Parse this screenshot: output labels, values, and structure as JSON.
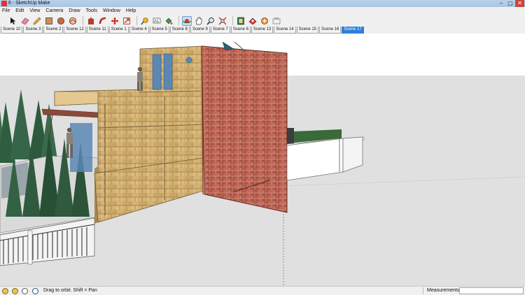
{
  "window": {
    "title": "6 - SketchUp Make",
    "controls": [
      "–",
      "▢",
      "✕"
    ]
  },
  "menu": [
    "File",
    "Edit",
    "View",
    "Camera",
    "Draw",
    "Tools",
    "Window",
    "Help"
  ],
  "toolbar": {
    "tools": [
      "select-tool-icon",
      "eraser-tool-icon",
      "pencil-tool-icon",
      "rectangle-tool-icon",
      "circle-tool-icon",
      "arc-tool-icon",
      "push-pull-tool-icon",
      "follow-me-tool-icon",
      "move-tool-icon",
      "rotate-tool-icon",
      "scale-tool-icon",
      "offset-tool-icon",
      "tape-measure-tool-icon",
      "text-tool-icon",
      "paint-bucket-tool-icon",
      "orbit-tool-icon",
      "pan-tool-icon",
      "zoom-tool-icon",
      "zoom-extents-tool-icon",
      "3d-warehouse-icon",
      "extension-warehouse-icon",
      "share-model-icon",
      "layout-icon"
    ],
    "active_tool": "orbit-tool-icon"
  },
  "scene_tabs": {
    "items": [
      "Scene 10",
      "Scene 3",
      "Scene 2",
      "Scene 12",
      "Scene 11",
      "Scene 1",
      "Scene 4",
      "Scene 5",
      "Scene 8",
      "Scene 9",
      "Scene 7",
      "Scene 6",
      "Scene 13",
      "Scene 14",
      "Scene 15",
      "Scene 16",
      "Scene 17"
    ],
    "active": "Scene 17"
  },
  "statusbar": {
    "message": "Drag to orbit.  Shift = Pan",
    "measurements_label": "Measurements",
    "measurements_value": ""
  },
  "colors": {
    "accent": "#2f7fd8",
    "sky": "#ffffff",
    "ground": "#dedede",
    "sandstone": "#d4b274",
    "brick": "#b55a4a",
    "tree": "#2f5e3e"
  }
}
